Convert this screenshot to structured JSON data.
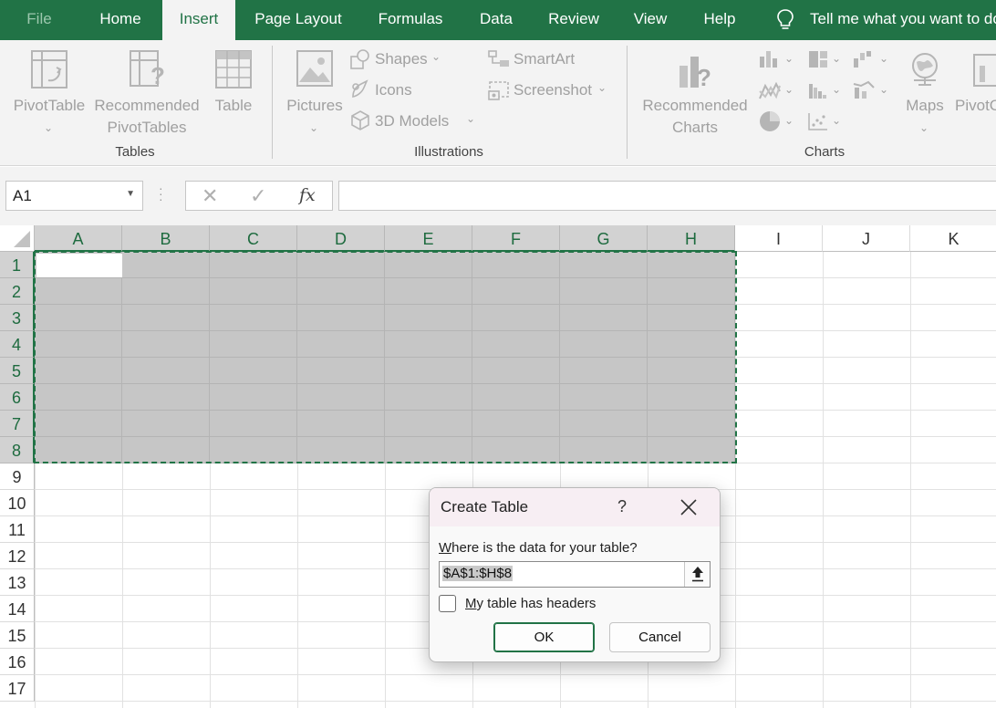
{
  "ribbon_tabs": {
    "file": "File",
    "home": "Home",
    "insert": "Insert",
    "page_layout": "Page Layout",
    "formulas": "Formulas",
    "data": "Data",
    "review": "Review",
    "view": "View",
    "help": "Help",
    "tell_me": "Tell me what you want to do",
    "active": "Insert"
  },
  "ribbon": {
    "tables": {
      "group_label": "Tables",
      "pivot_table": "PivotTable",
      "recommended_pivot_line1": "Recommended",
      "recommended_pivot_line2": "PivotTables",
      "table": "Table"
    },
    "illustrations": {
      "group_label": "Illustrations",
      "pictures": "Pictures",
      "shapes": "Shapes",
      "icons": "Icons",
      "models_3d": "3D Models",
      "smartart": "SmartArt",
      "screenshot": "Screenshot"
    },
    "charts": {
      "group_label": "Charts",
      "recommended_line1": "Recommended",
      "recommended_line2": "Charts",
      "maps": "Maps",
      "pivot_chart_partial": "PivotC"
    }
  },
  "formula_bar": {
    "name_box": "A1",
    "fx": "fx",
    "cancel_glyph": "✕",
    "enter_glyph": "✓",
    "value": ""
  },
  "grid": {
    "columns": [
      "A",
      "B",
      "C",
      "D",
      "E",
      "F",
      "G",
      "H",
      "I",
      "J",
      "K"
    ],
    "rows": [
      "1",
      "2",
      "3",
      "4",
      "5",
      "6",
      "7",
      "8",
      "9",
      "10",
      "11",
      "12",
      "13",
      "14",
      "15",
      "16",
      "17"
    ],
    "selected_range": "A1:H8",
    "active_cell": "A1"
  },
  "dialog": {
    "title": "Create Table",
    "help": "?",
    "prompt_underlined": "W",
    "prompt_rest": "here is the data for your table?",
    "range_value": "$A$1:$H$8",
    "checkbox_underlined": "M",
    "checkbox_rest": "y table has headers",
    "checkbox_checked": false,
    "ok": "OK",
    "cancel": "Cancel"
  },
  "colors": {
    "accent": "#217346",
    "ribbon_bg": "#f3f3f3",
    "selection_fill": "#c6c6c6"
  }
}
